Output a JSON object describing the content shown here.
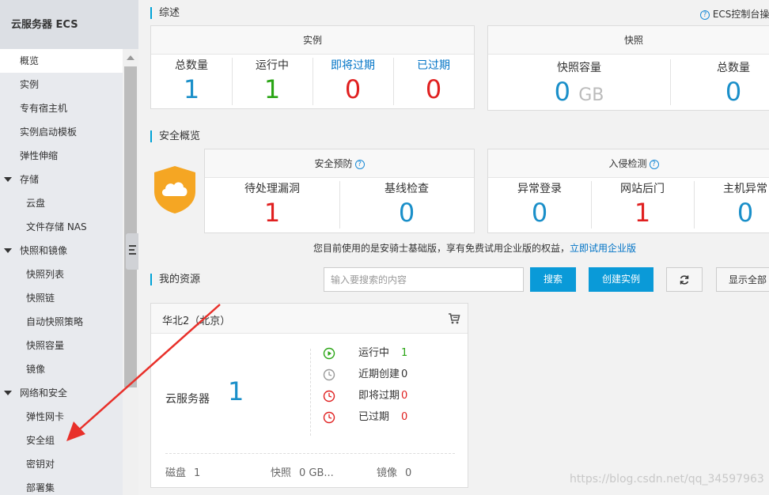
{
  "sidebar": {
    "title": "云服务器 ECS",
    "items": [
      {
        "label": "概览",
        "level": 1,
        "active": true
      },
      {
        "label": "实例",
        "level": 1
      },
      {
        "label": "专有宿主机",
        "level": 1
      },
      {
        "label": "实例启动模板",
        "level": 1
      },
      {
        "label": "弹性伸缩",
        "level": 1
      },
      {
        "label": "存储",
        "level": 1,
        "group": true
      },
      {
        "label": "云盘",
        "level": 2
      },
      {
        "label": "文件存储 NAS",
        "level": 2
      },
      {
        "label": "快照和镜像",
        "level": 1,
        "group": true
      },
      {
        "label": "快照列表",
        "level": 2
      },
      {
        "label": "快照链",
        "level": 2
      },
      {
        "label": "自动快照策略",
        "level": 2
      },
      {
        "label": "快照容量",
        "level": 2
      },
      {
        "label": "镜像",
        "level": 2
      },
      {
        "label": "网络和安全",
        "level": 1,
        "group": true
      },
      {
        "label": "弹性网卡",
        "level": 2
      },
      {
        "label": "安全组",
        "level": 2
      },
      {
        "label": "密钥对",
        "level": 2
      },
      {
        "label": "部署集",
        "level": 2
      }
    ]
  },
  "overview": {
    "title": "综述",
    "console_link": "ECS控制台操作",
    "instance_panel": {
      "title": "实例",
      "stats": [
        {
          "label": "总数量",
          "value": "1",
          "label_color": "#333333",
          "value_color": "#1a8fc9"
        },
        {
          "label": "运行中",
          "value": "1",
          "label_color": "#333333",
          "value_color": "#2aa515"
        },
        {
          "label": "即将过期",
          "value": "0",
          "label_color": "#0073c6",
          "value_color": "#e02020"
        },
        {
          "label": "已过期",
          "value": "0",
          "label_color": "#0073c6",
          "value_color": "#e02020"
        }
      ]
    },
    "snapshot_panel": {
      "title": "快照",
      "capacity_label": "快照容量",
      "capacity_value": "0",
      "capacity_unit": "GB",
      "count_label": "总数量",
      "count_value": "0"
    }
  },
  "security": {
    "title": "安全概览",
    "warning_panel": {
      "title": "安全预防",
      "help": "?",
      "stats": [
        {
          "label": "待处理漏洞",
          "value": "1",
          "value_color": "#e02020"
        },
        {
          "label": "基线检查",
          "value": "0",
          "value_color": "#1a8fc9"
        }
      ]
    },
    "intrusion_panel": {
      "title": "入侵检测",
      "help": "?",
      "stats": [
        {
          "label": "异常登录",
          "value": "0",
          "value_color": "#1a8fc9"
        },
        {
          "label": "网站后门",
          "value": "1",
          "value_color": "#e02020"
        },
        {
          "label": "主机异常",
          "value": "0",
          "value_color": "#1a8fc9"
        }
      ]
    },
    "notice_text": "您目前使用的是安骑士基础版，享有免费试用企业版的权益，",
    "notice_link": "立即试用企业版"
  },
  "resources": {
    "title": "我的资源",
    "search_placeholder": "输入要搜索的内容",
    "search_button": "搜索",
    "create_button": "创建实例",
    "show_all_button": "显示全部",
    "region": {
      "name": "华北2（北京）",
      "service_label": "云服务器",
      "service_count": "1",
      "statuses": [
        {
          "label": "运行中",
          "value": "1",
          "value_color": "#2aa515",
          "icon": "play-circle-icon"
        },
        {
          "label": "近期创建",
          "value": "0",
          "value_color": "#333333",
          "icon": "clock-plus-icon"
        },
        {
          "label": "即将过期",
          "value": "0",
          "value_color": "#e02020",
          "icon": "expiring-clock-icon"
        },
        {
          "label": "已过期",
          "value": "0",
          "value_color": "#e02020",
          "icon": "expired-clock-icon"
        }
      ],
      "footer": [
        {
          "label": "磁盘",
          "value": "1"
        },
        {
          "label": "快照",
          "value": "0 GB..."
        },
        {
          "label": "镜像",
          "value": "0"
        }
      ]
    }
  },
  "watermark": "https://blog.csdn.net/qq_34597963",
  "colors": {
    "accent": "#00a2d7",
    "primary_button": "#0a9ad8",
    "shield": "#f5a623",
    "annotation_arrow": "#e8302a"
  }
}
